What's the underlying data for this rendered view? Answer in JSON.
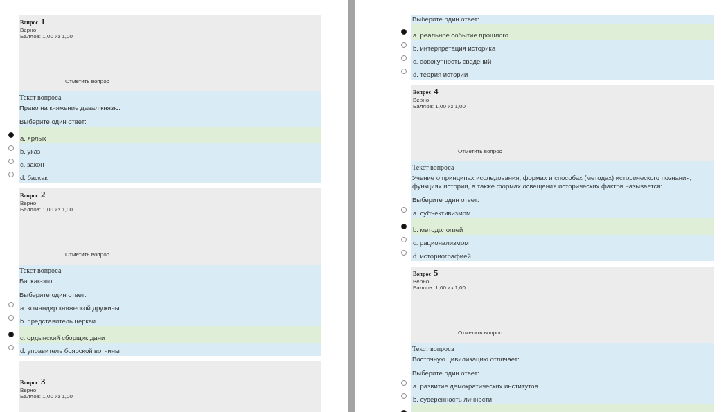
{
  "pages": [
    {
      "blocks": [
        {
          "header": {
            "label": "Вопрос",
            "number": "1",
            "status": "Верно",
            "score": "Баллов: 1,00 из 1,00",
            "flag": "Отметить вопрос"
          },
          "body": {
            "label": "Текст вопроса",
            "question": "Право на княжение давал князю:",
            "prompt": "Выберите один ответ:",
            "options": [
              {
                "label": "a. ярлык",
                "selected": true
              },
              {
                "label": "b. указ",
                "selected": false
              },
              {
                "label": "c. закон",
                "selected": false
              },
              {
                "label": "d. баскак",
                "selected": false
              }
            ]
          }
        },
        {
          "header": {
            "label": "Вопрос",
            "number": "2",
            "status": "Верно",
            "score": "Баллов: 1,00 из 1,00",
            "flag": "Отметить вопрос"
          },
          "body": {
            "label": "Текст вопроса",
            "question": "Баскак-это:",
            "prompt": "Выберите один ответ:",
            "options": [
              {
                "label": "a. командир княжеской дружины",
                "selected": false
              },
              {
                "label": "b. представитель церкви",
                "selected": false
              },
              {
                "label": "c. ордынский сборщик дани",
                "selected": true
              },
              {
                "label": "d. управитель боярской вотчины",
                "selected": false
              }
            ]
          }
        },
        {
          "header": {
            "label": "Вопрос",
            "number": "3",
            "status": "Верно",
            "score": "Баллов: 1,00 из 1,00"
          }
        }
      ]
    },
    {
      "blocks": [
        {
          "body": {
            "prompt": "Выберите один ответ:",
            "options": [
              {
                "label": "a. реальное событие прошлого",
                "selected": true
              },
              {
                "label": "b. интерпретация историка",
                "selected": false
              },
              {
                "label": "c. совокупность сведений",
                "selected": false
              },
              {
                "label": "d. теория истории",
                "selected": false
              }
            ]
          }
        },
        {
          "header": {
            "label": "Вопрос",
            "number": "4",
            "status": "Верно",
            "score": "Баллов: 1,00 из 1,00",
            "flag": "Отметить вопрос"
          },
          "body": {
            "label": "Текст вопроса",
            "question": "Учение о принципах исследования, формах и способах (методах) исторического познания, функциях истории, а также формах освещения исторических фактов называется:",
            "prompt": "Выберите один ответ:",
            "options": [
              {
                "label": "a. субъективизмом",
                "selected": false
              },
              {
                "label": "b. методологией",
                "selected": true
              },
              {
                "label": "c. рационализмом",
                "selected": false
              },
              {
                "label": "d. историографией",
                "selected": false
              }
            ]
          }
        },
        {
          "header": {
            "label": "Вопрос",
            "number": "5",
            "status": "Верно",
            "score": "Баллов: 1,00 из 1,00",
            "flag": "Отметить вопрос"
          },
          "body": {
            "label": "Текст вопроса",
            "question": "Восточную цивилизацию отличает:",
            "prompt": "Выберите один ответ:",
            "options": [
              {
                "label": "a. развитие демократических институтов",
                "selected": false
              },
              {
                "label": "b. суверенность личности",
                "selected": false
              },
              {
                "selected": true
              }
            ]
          }
        }
      ]
    }
  ]
}
